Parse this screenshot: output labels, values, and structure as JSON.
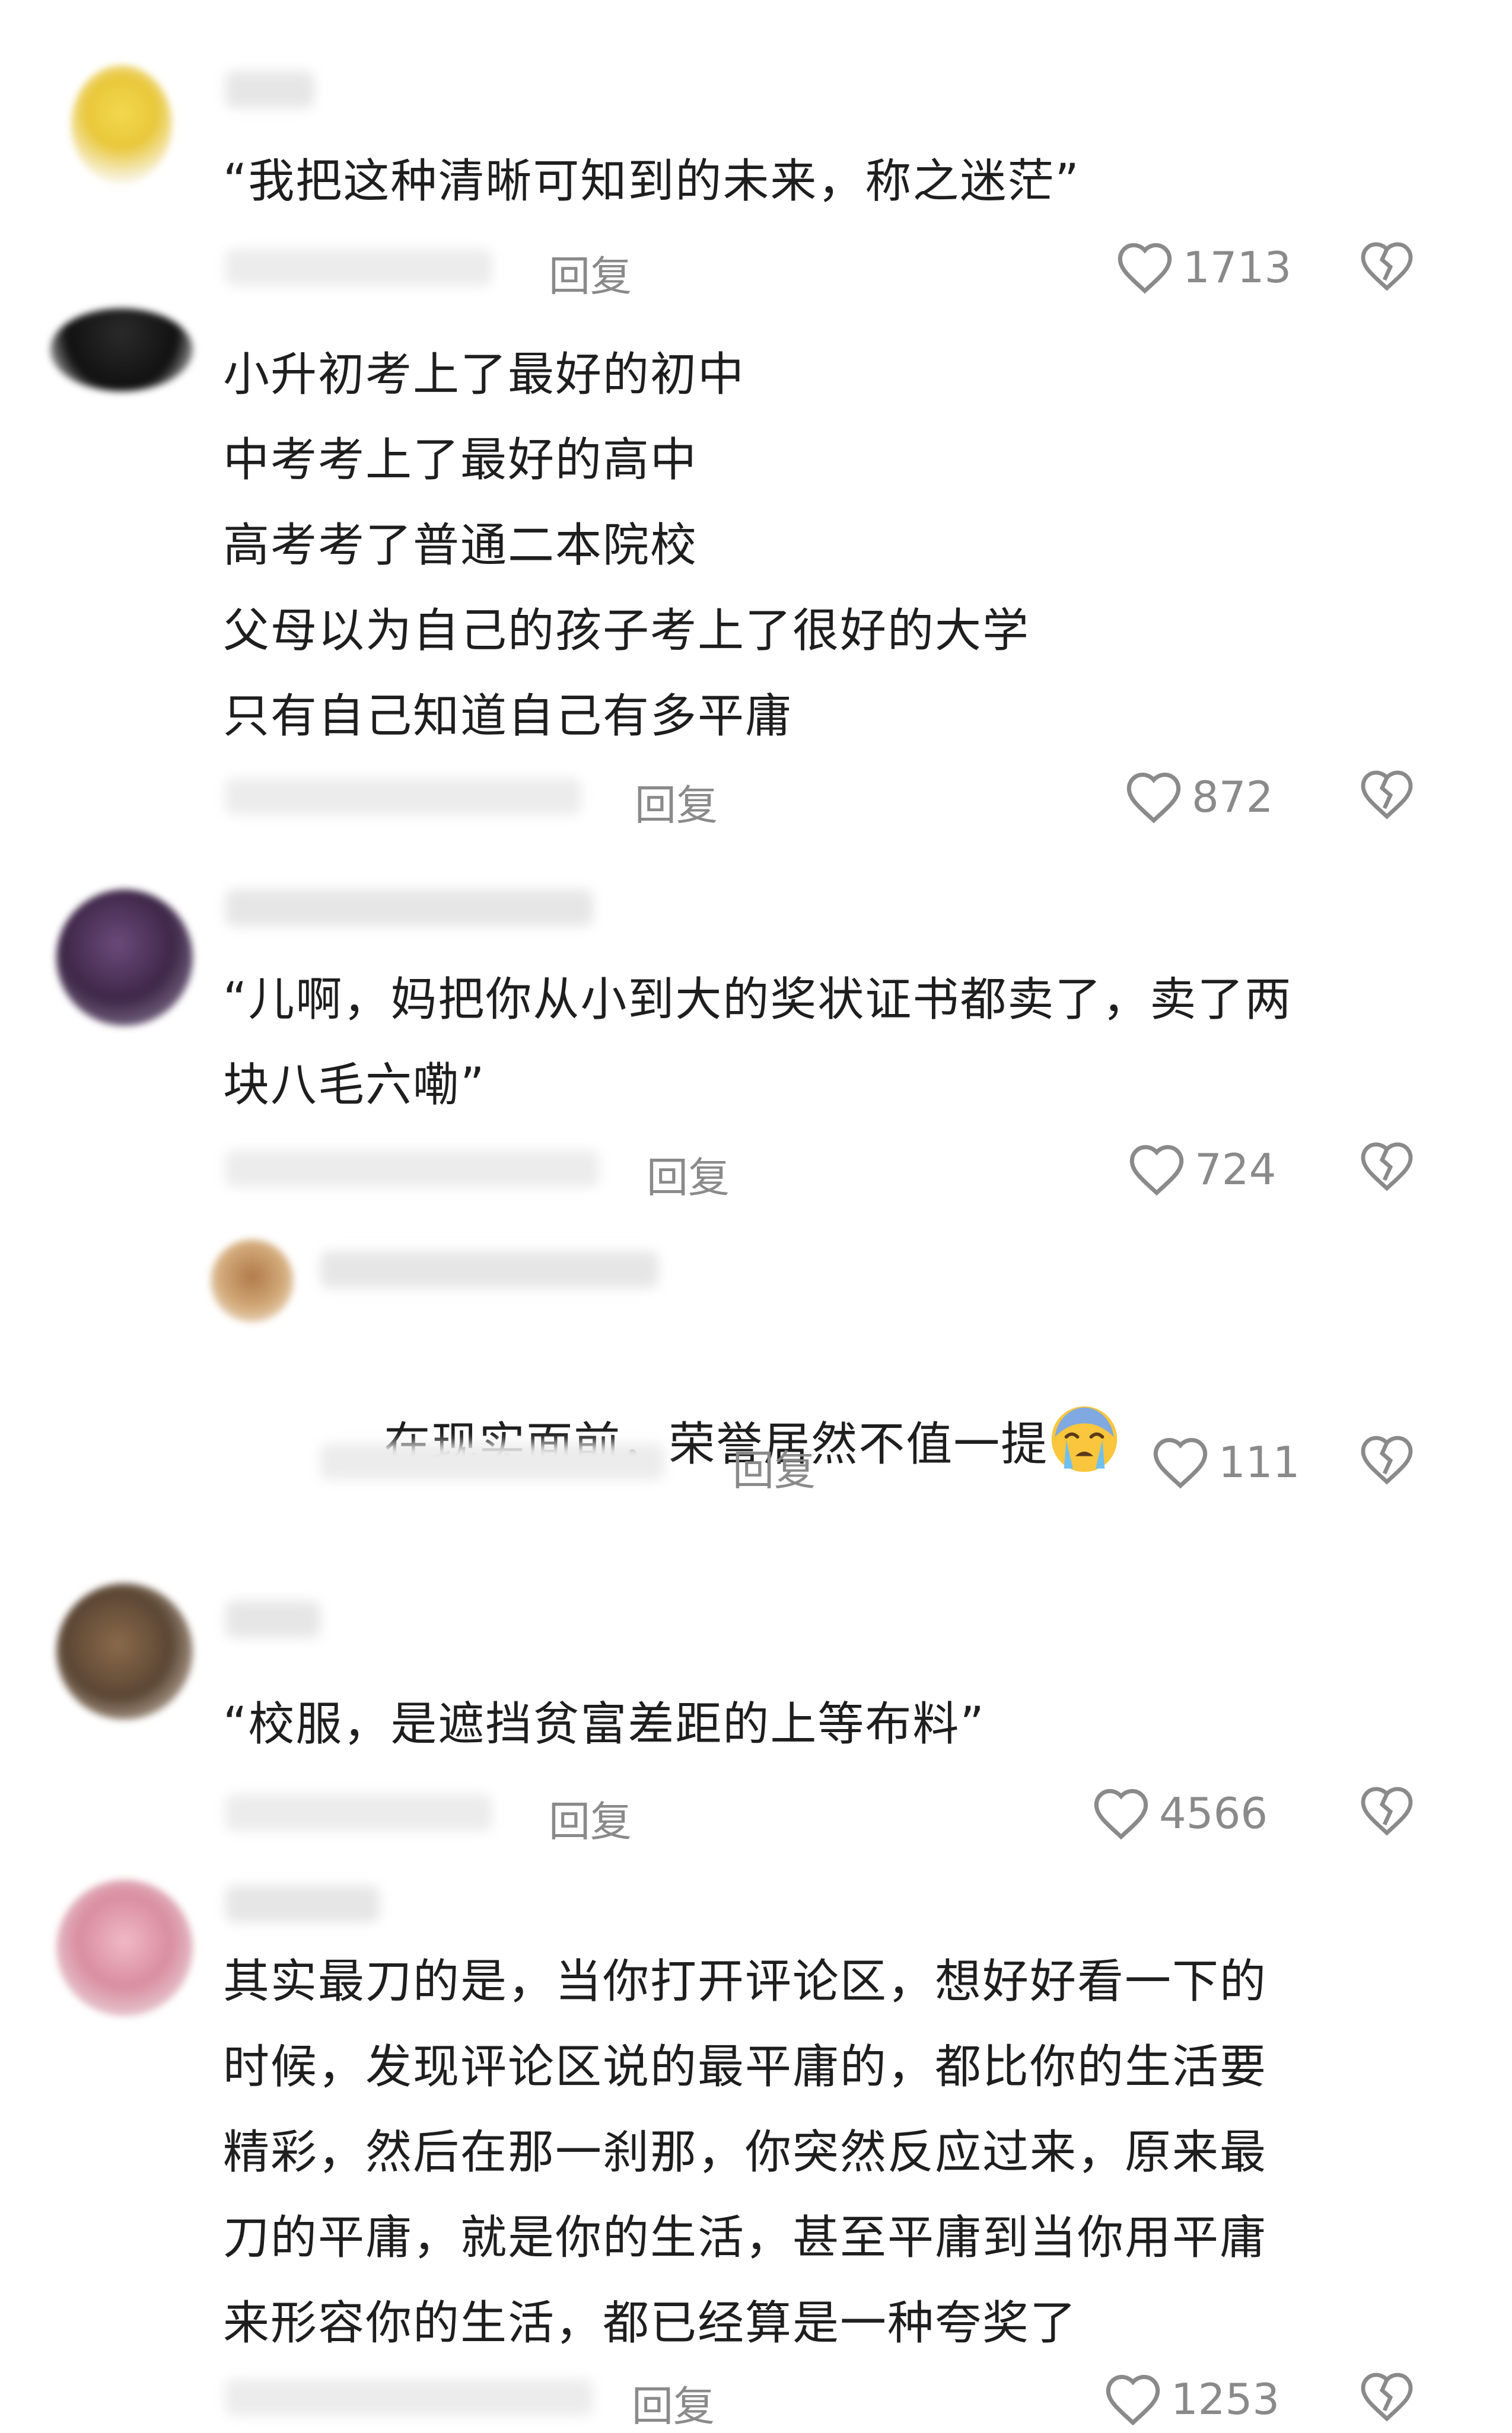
{
  "comments": [
    {
      "text": "“我把这种清晰可知到的未来，称之迷茫”",
      "reply_label": "回复",
      "likes": "1713"
    },
    {
      "text": "小升初考上了最好的初中\n中考考上了最好的高中\n高考考了普通二本院校\n父母以为自己的孩子考上了很好的大学\n只有自己知道自己有多平庸",
      "reply_label": "回复",
      "likes": "872"
    },
    {
      "text": "“儿啊，妈把你从小到大的奖状证书都卖了，卖了两\n块八毛六嘞”",
      "reply_label": "回复",
      "likes": "724"
    },
    {
      "text": "在现实面前，荣誉居然不值一提",
      "emoji": "crying-face",
      "reply_label": "回复",
      "likes": "111"
    },
    {
      "text": "“校服，是遮挡贫富差距的上等布料”",
      "reply_label": "回复",
      "likes": "4566"
    },
    {
      "text": "其实最刀的是，当你打开评论区，想好好看一下的\n时候，发现评论区说的最平庸的，都比你的生活要\n精彩，然后在那一刹那，你突然反应过来，原来最\n刀的平庸，就是你的生活，甚至平庸到当你用平庸\n来形容你的生活，都已经算是一种夸奖了",
      "reply_label": "回复",
      "likes": "1253"
    }
  ],
  "colors": {
    "meta_gray": "#8a8a8a",
    "text": "#1e1e1e"
  }
}
